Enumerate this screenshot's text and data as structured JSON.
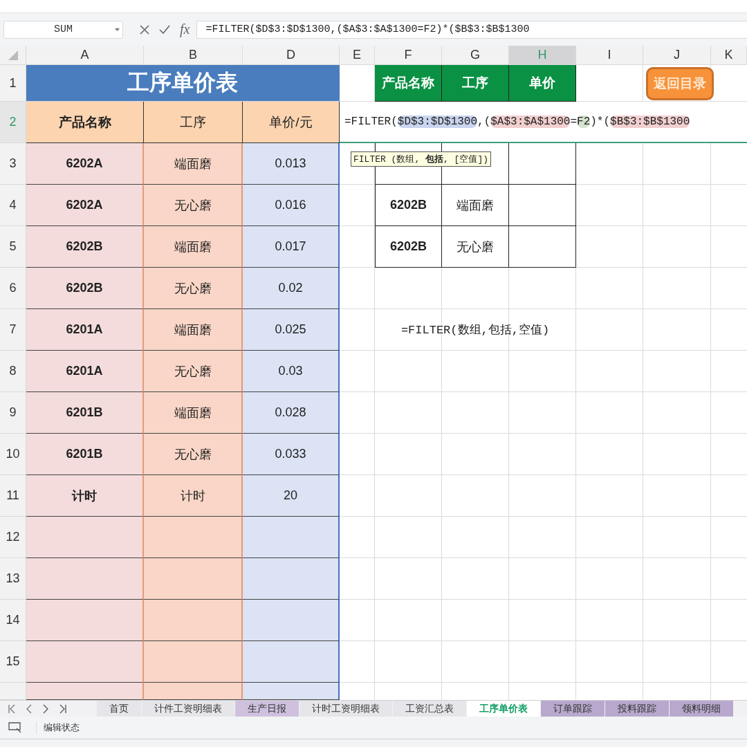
{
  "formula_bar": {
    "name_box": "SUM",
    "function_label": "fx",
    "formula": "=FILTER($D$3:$D$1300,($A$3:$A$1300=F2)*($B$3:$B$1300"
  },
  "column_headers": [
    {
      "label": "A",
      "selected": false
    },
    {
      "label": "B",
      "selected": false
    },
    {
      "label": "D",
      "selected": false
    },
    {
      "label": "E",
      "selected": false
    },
    {
      "label": "F",
      "selected": false
    },
    {
      "label": "G",
      "selected": false
    },
    {
      "label": "H",
      "selected": true
    },
    {
      "label": "I",
      "selected": false
    },
    {
      "label": "J",
      "selected": false
    },
    {
      "label": "K",
      "selected": false
    }
  ],
  "row_headers": [
    {
      "label": "1",
      "selected": false
    },
    {
      "label": "2",
      "selected": true
    },
    {
      "label": "3",
      "selected": false
    },
    {
      "label": "4",
      "selected": false
    },
    {
      "label": "5",
      "selected": false
    },
    {
      "label": "6",
      "selected": false
    },
    {
      "label": "7",
      "selected": false
    },
    {
      "label": "8",
      "selected": false
    },
    {
      "label": "9",
      "selected": false
    },
    {
      "label": "10",
      "selected": false
    },
    {
      "label": "11",
      "selected": false
    },
    {
      "label": "12",
      "selected": false
    },
    {
      "label": "13",
      "selected": false
    },
    {
      "label": "14",
      "selected": false
    },
    {
      "label": "15",
      "selected": false
    }
  ],
  "price_table": {
    "title": "工序单价表",
    "headers": [
      "产品名称",
      "工序",
      "单价/元"
    ],
    "rows": [
      {
        "product": "6202A",
        "process": "端面磨",
        "price": "0.013"
      },
      {
        "product": "6202A",
        "process": "无心磨",
        "price": "0.016"
      },
      {
        "product": "6202B",
        "process": "端面磨",
        "price": "0.017"
      },
      {
        "product": "6202B",
        "process": "无心磨",
        "price": "0.02"
      },
      {
        "product": "6201A",
        "process": "端面磨",
        "price": "0.025"
      },
      {
        "product": "6201A",
        "process": "无心磨",
        "price": "0.03"
      },
      {
        "product": "6201B",
        "process": "端面磨",
        "price": "0.028"
      },
      {
        "product": "6201B",
        "process": "无心磨",
        "price": "0.033"
      },
      {
        "product": "计时",
        "process": "计时",
        "price": "20"
      }
    ]
  },
  "lookup_table": {
    "headers": [
      "产品名称",
      "工序",
      "单价"
    ],
    "rows": [
      {
        "product": "6202B",
        "process": "端面磨"
      },
      {
        "product": "6202B",
        "process": "无心磨"
      }
    ]
  },
  "note": "=FILTER(数组,包括,空值)",
  "back_button": "返回目录",
  "cell_editor": {
    "segments": [
      {
        "text": "=FILTER(",
        "kind": "plain"
      },
      {
        "text": "$D$3:$D$1300",
        "kind": "ref",
        "color": "#c9d5ef"
      },
      {
        "text": ",(",
        "kind": "plain"
      },
      {
        "text": "$A$3:$A$1300",
        "kind": "ref",
        "color": "#f2cfcf"
      },
      {
        "text": "=",
        "kind": "plain"
      },
      {
        "text": "F2",
        "kind": "ref",
        "color": "#d3e3cf"
      },
      {
        "text": ")*(",
        "kind": "plain"
      },
      {
        "text": "$B$3:$B$1300",
        "kind": "ref",
        "color": "#f2cfcf"
      }
    ]
  },
  "tooltip": "FILTER (数组, **包括**, [空值])",
  "sheet_tabs": [
    {
      "label": "首页",
      "selected": false,
      "color": "#e6e6ea"
    },
    {
      "label": "计件工资明细表",
      "selected": false,
      "color": "#e6e6ea"
    },
    {
      "label": "生产日报",
      "selected": false,
      "color": "#cfc1de"
    },
    {
      "label": "计时工资明细表",
      "selected": false,
      "color": "#e6e6ea"
    },
    {
      "label": "工资汇总表",
      "selected": false,
      "color": "#e6e6ea"
    },
    {
      "label": "工序单价表",
      "selected": true,
      "color": "#ffffff"
    },
    {
      "label": "订单跟踪",
      "selected": false,
      "color": "#b8a8cd"
    },
    {
      "label": "投料跟踪",
      "selected": false,
      "color": "#b8a8cd"
    },
    {
      "label": "领料明细",
      "selected": false,
      "color": "#b8a8cd"
    }
  ],
  "status_bar": {
    "mode": "编辑状态"
  }
}
